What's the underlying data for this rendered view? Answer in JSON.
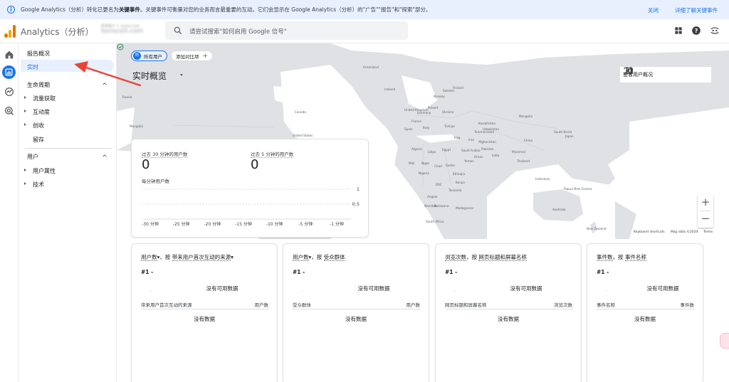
{
  "banner": {
    "message_before": "Google Analytics（分析）转化已更名为",
    "message_bold": "关键事件",
    "message_after": "。关键事件可衡量对您的业务而言最重要的互动。它们会显示在 Google Analytics（分析）的\"广告\"\"报告\"和\"探索\"部分。",
    "close_label": "关闭",
    "learn_more_label": "详细了解关键事件"
  },
  "header": {
    "app_title": "Analytics（分析）",
    "account_subtitle": "所有帐户 > xxxxx.com",
    "account_name": "bonscell.com",
    "search_placeholder": "请尝试搜索\"如何启用 Google 信号\""
  },
  "sidenav": {
    "items": [
      {
        "label": "报告概况"
      },
      {
        "label": "实时"
      }
    ],
    "sections": [
      {
        "title": "生命周期",
        "items": [
          {
            "label": "流量获取",
            "expandable": true
          },
          {
            "label": "互动度",
            "expandable": true
          },
          {
            "label": "创收",
            "expandable": true
          },
          {
            "label": "留存",
            "expandable": false
          }
        ]
      },
      {
        "title": "用户",
        "items": [
          {
            "label": "用户属性",
            "expandable": true
          },
          {
            "label": "技术",
            "expandable": true
          }
        ]
      }
    ]
  },
  "realtime": {
    "filter_chip_avatar": "所",
    "filter_chip": "所有用户",
    "add_comparison": "添加对比项",
    "title": "实时概览",
    "view_user_snapshot": "查看用户概况",
    "metric1_label": "过去 30 分钟的用户数",
    "metric1_value": "0",
    "metric2_label": "过去 5 分钟的用户数",
    "metric2_value": "0",
    "per_minute_label": "每分钟用户数"
  },
  "map": {
    "labels": [
      "Greenland",
      "Russia",
      "Canada",
      "United States",
      "Mexico",
      "Brazil",
      "Argentina",
      "Colombia",
      "Peru",
      "Bolivia",
      "Chile",
      "Venezuela",
      "Iceland",
      "Norway",
      "Sweden",
      "Finland",
      "United Kingdom",
      "Germany",
      "Poland",
      "Ukraine",
      "France",
      "Spain",
      "Italy",
      "Türkiye",
      "Kazakhstan",
      "Mongolia",
      "China",
      "Japan",
      "South Korea",
      "Iran",
      "Iraq",
      "Saudi Arabia",
      "Egypt",
      "Libya",
      "Algeria",
      "Mali",
      "Niger",
      "Chad",
      "Sudan",
      "Ethiopia",
      "Nigeria",
      "DRC",
      "Kenya",
      "Tanzania",
      "Angola",
      "Namibia",
      "Botswana",
      "South Africa",
      "Madagascar",
      "Afghanistan",
      "Pakistan",
      "India",
      "Myanmar",
      "Thailand",
      "Indonesia",
      "Papua New Guinea",
      "Australia",
      "New Zealand",
      "Turkmenistan",
      "Uzbekistan",
      "Yemen",
      "Oman"
    ],
    "keyboard_shortcuts": "Keyboard shortcuts",
    "map_data": "Map data ©2024",
    "terms": "Terms",
    "colors": {
      "water": "#ffffff",
      "land": "#dfe1e5"
    }
  },
  "chart_data": {
    "type": "bar",
    "x": [
      "-30 分钟",
      "-25 分钟",
      "-20 分钟",
      "-15 分钟",
      "-10 分钟",
      "-5 分钟",
      "-1 分钟"
    ],
    "yticks": [
      "1",
      "0.5"
    ],
    "ylim": [
      0,
      1
    ],
    "values": []
  },
  "cards": [
    {
      "title_metric": "用户数",
      "title_mid": "，按",
      "title_dim": "带来用户首次互动的来源",
      "has_dropdown": true,
      "rank": "#1  -",
      "no_data_top": "没有可用数据",
      "dim_header": "带来用户首次互动的来源",
      "metric_header": "用户数",
      "no_data_bottom": "没有数据"
    },
    {
      "title_metric": "用户数",
      "title_mid": "，按",
      "title_dim": "受众群体",
      "has_dropdown": true,
      "rank": "#1  -",
      "no_data_top": "没有可用数据",
      "dim_header": "受众群体",
      "metric_header": "用户数",
      "no_data_bottom": "没有数据"
    },
    {
      "title_metric": "浏览次数",
      "title_mid": "，按",
      "title_dim": "网页标题和屏幕名称",
      "has_dropdown": false,
      "rank": "#1  -",
      "no_data_top": "没有可用数据",
      "dim_header": "网页标题和屏幕名称",
      "metric_header": "浏览次数",
      "no_data_bottom": "没有数据"
    },
    {
      "title_metric": "事件数",
      "title_mid": "，按",
      "title_dim": "事件名称",
      "has_dropdown": false,
      "rank": "#1  -",
      "no_data_top": "没有可用数据",
      "dim_header": "事件名称",
      "metric_header": "事件数",
      "no_data_bottom": "没有数据"
    }
  ],
  "colors": {
    "accent": "#1a73e8",
    "annotation_arrow": "#ea4335",
    "logo_orange": "#f9ab00",
    "logo_dark": "#e37400"
  }
}
